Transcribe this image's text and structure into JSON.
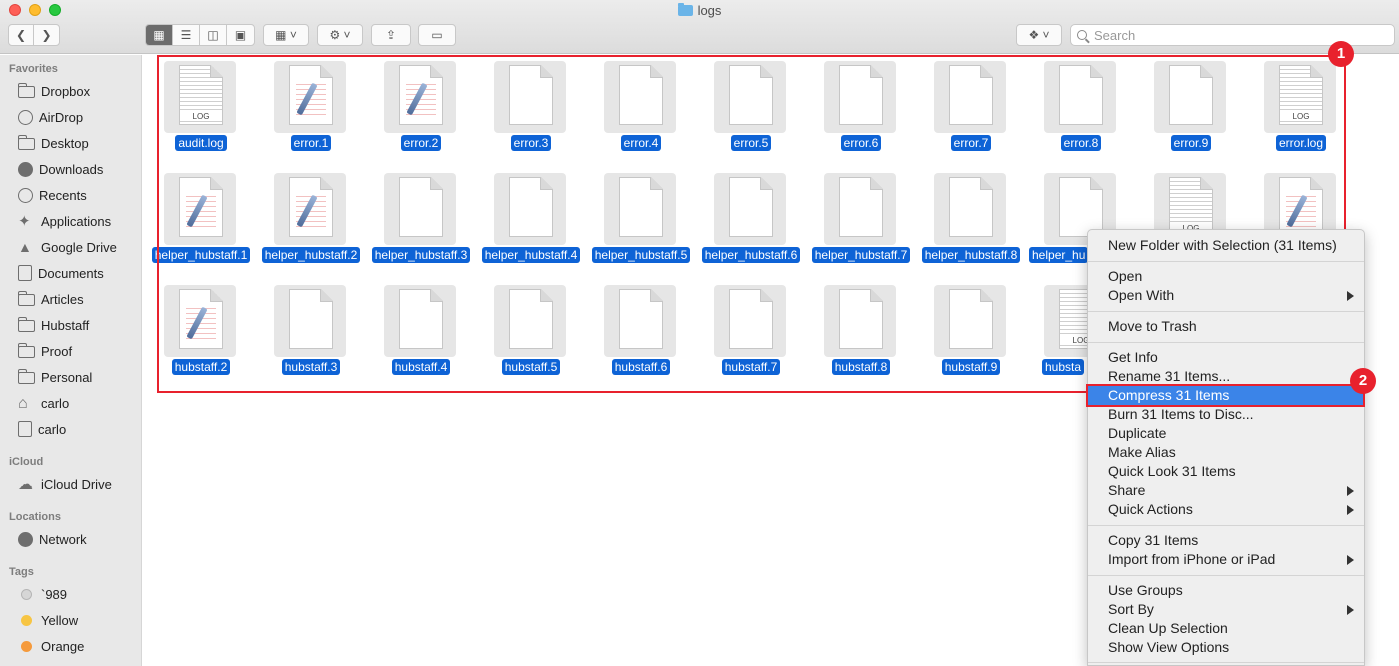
{
  "window": {
    "title": "logs"
  },
  "toolbar": {
    "search_placeholder": "Search"
  },
  "sidebar": {
    "favorites_heading": "Favorites",
    "favorites": [
      {
        "label": "Dropbox",
        "icon": "dropbox-icon"
      },
      {
        "label": "AirDrop",
        "icon": "airdrop-icon"
      },
      {
        "label": "Desktop",
        "icon": "desktop-icon"
      },
      {
        "label": "Downloads",
        "icon": "downloads-icon"
      },
      {
        "label": "Recents",
        "icon": "recents-icon"
      },
      {
        "label": "Applications",
        "icon": "applications-icon"
      },
      {
        "label": "Google Drive",
        "icon": "google-drive-icon"
      },
      {
        "label": "Documents",
        "icon": "documents-icon"
      },
      {
        "label": "Articles",
        "icon": "folder-icon"
      },
      {
        "label": "Hubstaff",
        "icon": "folder-icon"
      },
      {
        "label": "Proof",
        "icon": "folder-icon"
      },
      {
        "label": "Personal",
        "icon": "folder-icon"
      },
      {
        "label": "carlo",
        "icon": "home-icon"
      },
      {
        "label": "carlo",
        "icon": "disk-icon"
      }
    ],
    "icloud_heading": "iCloud",
    "icloud": [
      {
        "label": "iCloud Drive",
        "icon": "cloud-icon"
      }
    ],
    "locations_heading": "Locations",
    "locations": [
      {
        "label": "Network",
        "icon": "network-icon"
      }
    ],
    "tags_heading": "Tags",
    "tags": [
      {
        "label": "`989",
        "color": "#d6d6d6"
      },
      {
        "label": "Yellow",
        "color": "#f7c543"
      },
      {
        "label": "Orange",
        "color": "#f59a3c"
      }
    ]
  },
  "files": {
    "row1": [
      "audit.log",
      "error.1",
      "error.2",
      "error.3",
      "error.4",
      "error.5",
      "error.6",
      "error.7",
      "error.8",
      "error.9",
      "error.log"
    ],
    "row2": [
      "helper_hubstaff.1",
      "helper_hubstaff.2",
      "helper_hubstaff.3",
      "helper_hubstaff.4",
      "helper_hubstaff.5",
      "helper_hubstaff.6",
      "helper_hubstaff.7",
      "helper_hubstaff.8",
      "helper_hu"
    ],
    "row3": [
      "hubstaff.2",
      "hubstaff.3",
      "hubstaff.4",
      "hubstaff.5",
      "hubstaff.6",
      "hubstaff.7",
      "hubstaff.8",
      "hubstaff.9",
      "hubsta"
    ]
  },
  "annotations": {
    "badge1": "1",
    "badge2": "2"
  },
  "context_menu": {
    "new_folder": "New Folder with Selection (31 Items)",
    "open": "Open",
    "open_with": "Open With",
    "move_to_trash": "Move to Trash",
    "get_info": "Get Info",
    "rename": "Rename 31 Items...",
    "compress": "Compress 31 Items",
    "burn": "Burn 31 Items to Disc...",
    "duplicate": "Duplicate",
    "make_alias": "Make Alias",
    "quick_look": "Quick Look 31 Items",
    "share": "Share",
    "quick_actions": "Quick Actions",
    "copy": "Copy 31 Items",
    "import_iphone": "Import from iPhone or iPad",
    "use_groups": "Use Groups",
    "sort_by": "Sort By",
    "clean_up": "Clean Up Selection",
    "show_view_options": "Show View Options"
  }
}
